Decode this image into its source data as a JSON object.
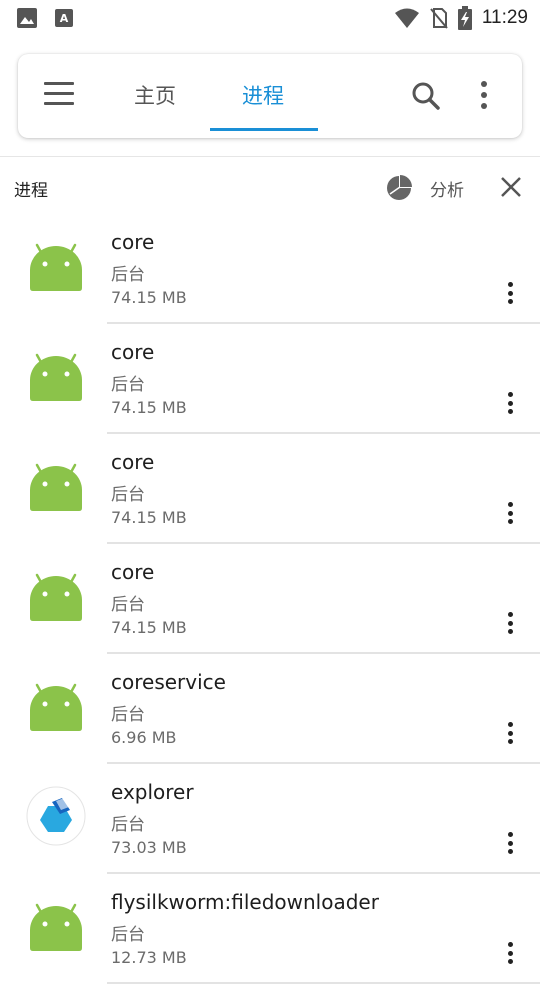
{
  "status_bar": {
    "time": "11:29",
    "icons": [
      "image-icon",
      "font-icon",
      "wifi-icon",
      "no-sim-icon",
      "battery-charging-icon"
    ]
  },
  "toolbar": {
    "tabs": [
      {
        "label": "主页",
        "active": false
      },
      {
        "label": "进程",
        "active": true
      }
    ],
    "accent_color": "#1a8fd6"
  },
  "subheader": {
    "title": "进程",
    "analyze_label": "分析"
  },
  "processes": [
    {
      "name": "core",
      "status": "后台",
      "size": "74.15 MB",
      "icon": "android-icon"
    },
    {
      "name": "core",
      "status": "后台",
      "size": "74.15 MB",
      "icon": "android-icon"
    },
    {
      "name": "core",
      "status": "后台",
      "size": "74.15 MB",
      "icon": "android-icon"
    },
    {
      "name": "core",
      "status": "后台",
      "size": "74.15 MB",
      "icon": "android-icon"
    },
    {
      "name": "coreservice",
      "status": "后台",
      "size": "6.96 MB",
      "icon": "android-icon"
    },
    {
      "name": "explorer",
      "status": "后台",
      "size": "73.03 MB",
      "icon": "explorer-app-icon"
    },
    {
      "name": "flysilkworm:filedownloader",
      "status": "后台",
      "size": "12.73 MB",
      "icon": "android-icon"
    }
  ]
}
